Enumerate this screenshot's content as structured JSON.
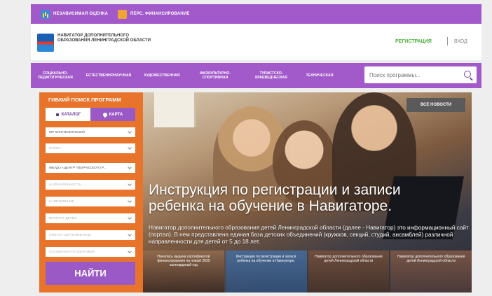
{
  "topbar": {
    "items": [
      {
        "label": "Независимая оценка",
        "icon": "chart-icon"
      },
      {
        "label": "Перс. финансирование",
        "icon": "card-icon"
      }
    ]
  },
  "header": {
    "logo_text": "НАВИГАТОР ДОПОЛНИТЕЛЬНОГО ОБРАЗОВАНИЯ ЛЕНИНГРАДСКОЙ ОБЛАСТИ",
    "register_label": "РЕГИСТРАЦИЯ",
    "login_label": "ВХОД"
  },
  "nav": {
    "items": [
      {
        "label": "СОЦИАЛЬНО-ПЕДАГОГИЧЕСКАЯ"
      },
      {
        "label": "ЕСТЕСТВЕННОНАУЧНАЯ"
      },
      {
        "label": "ХУДОЖЕСТВЕННАЯ"
      },
      {
        "label": "ФИЗКУЛЬТУРНО-СПОРТИВНАЯ"
      },
      {
        "label": "ТУРИСТСКО-КРАЕВЕДЧЕСКАЯ"
      },
      {
        "label": "ТЕХНИЧЕСКАЯ"
      }
    ],
    "search_placeholder": "Поиск программы..."
  },
  "filter": {
    "title": "ГИБКИЙ ПОИСК ПРОГРАММ",
    "tab_catalog": "КАТАЛОГ",
    "tab_map": "КАРТА",
    "selects": [
      "МР КИНГИСЕППСКИЙ",
      "РАЙОН",
      "МБУДО «ЦЕНТР ТВОРЧЕСКОГО Р...",
      "НАПРАВЛЕННОСТЬ",
      "НАПРАВЛЕНИЕ",
      "ВОЗРАСТ ДЕТЕЙ",
      "ОПЛАТА СЕРТИФИКАТОМ",
      "ОСОБЕННОСТИ ЗДОРОВЬЯ"
    ],
    "find_label": "НАЙТИ"
  },
  "hero": {
    "all_news_label": "ВСЕ НОВОСТИ",
    "title": "Инструкция по регистрации и записи ребенка на обучение в Навигаторе.",
    "description": "Навигатор дополнительного образования детей Ленинградской области (далее - Навигатор) это информационный сайт (портал). В нем представлена единая база детских объединений (кружков, секций, студий, ансамблей) различной направленности для детей от 5 до 18 лет.",
    "cards": [
      "Началась выдача сертификатов финансирования на новый 2020 календарный год",
      "Инструкция по регистрации и записи ребенка на обучение в Навигаторе.",
      "Навигатор дополнительного образования детей Ленинградской области",
      "Навигатор дополнительного образования детей Ленинградской области"
    ]
  }
}
